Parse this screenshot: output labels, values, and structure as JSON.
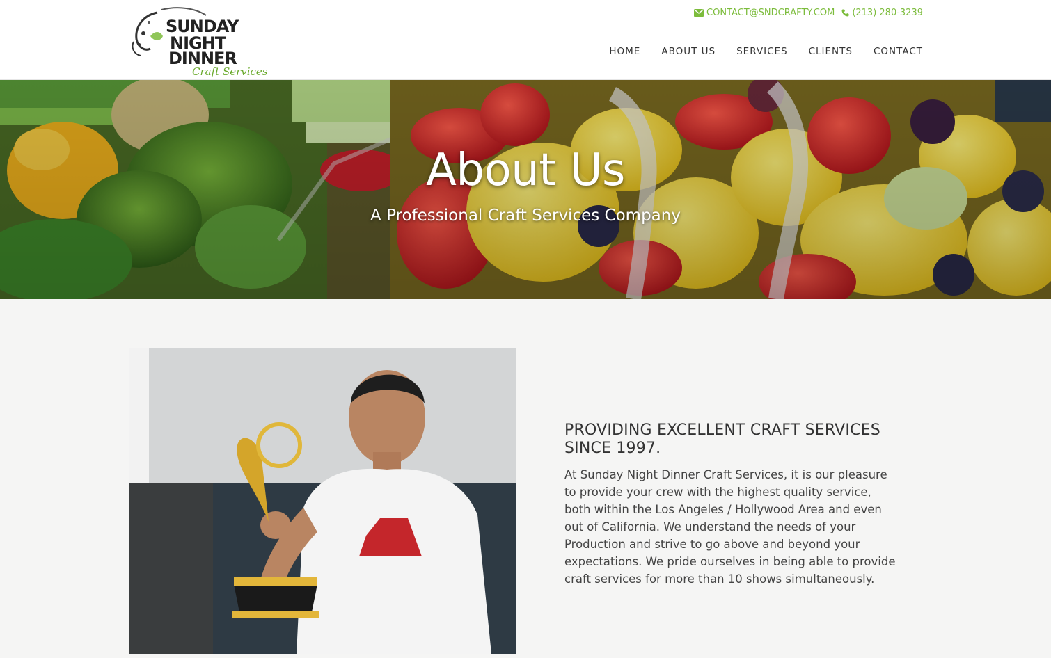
{
  "header": {
    "logo": {
      "line1": "SUNDAY",
      "line2": "NIGHT",
      "line3": "DINNER",
      "tagline": "Craft Services"
    },
    "contact": {
      "email": "CONTACT@SNDCRAFTY.COM",
      "phone": "(213) 280-3239",
      "email_icon": "envelope-icon",
      "phone_icon": "phone-icon"
    },
    "nav": [
      {
        "label": "HOME"
      },
      {
        "label": "ABOUT US"
      },
      {
        "label": "SERVICES"
      },
      {
        "label": "CLIENTS"
      },
      {
        "label": "CONTACT"
      }
    ]
  },
  "hero": {
    "title": "About Us",
    "subtitle": "A Professional Craft Services Company"
  },
  "about": {
    "heading": "PROVIDING EXCELLENT CRAFT SERVICES SINCE 1997.",
    "body": "At Sunday Night Dinner Craft Services, it is our pleasure to provide your crew with the highest quality service, both within the Los Angeles / Hollywood Area and even out of California. We understand the needs of your Production and strive to go above and beyond your expectations. We pride ourselves in being able to provide craft services for more than 10 shows simultaneously."
  },
  "colors": {
    "accent": "#7cbc3c",
    "nav_text": "#333333",
    "page_bg": "#f5f5f4"
  }
}
